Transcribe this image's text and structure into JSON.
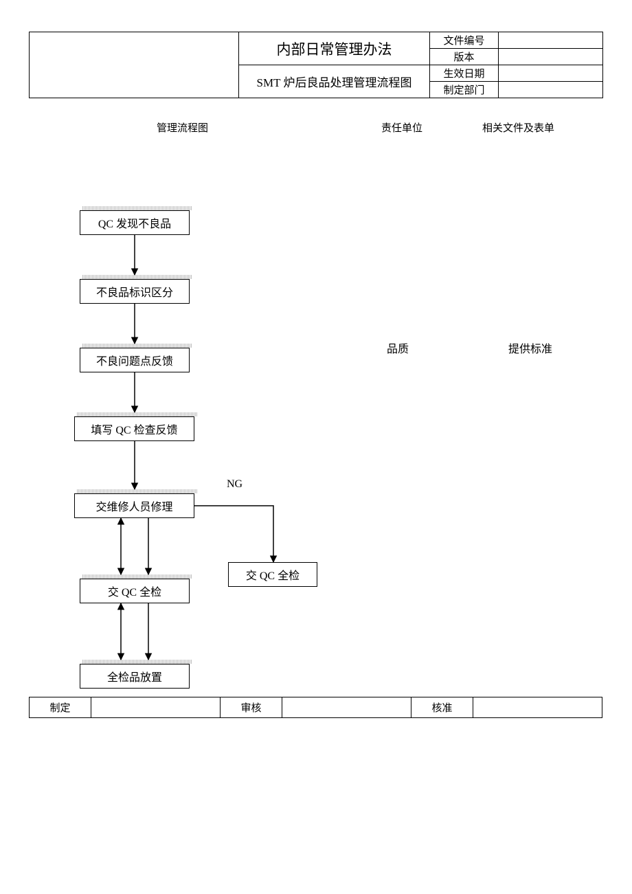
{
  "header": {
    "title1": "内部日常管理办法",
    "title2": "SMT 炉后良品处理管理流程图",
    "labels": {
      "docno": "文件编号",
      "ver": "版本",
      "eff": "生效日期",
      "dept": "制定部门"
    },
    "values": {
      "docno": "",
      "ver": "",
      "eff": "",
      "dept": ""
    }
  },
  "columns": {
    "flow": "管理流程图",
    "owner": "责任单位",
    "docs": "相关文件及表单"
  },
  "sidetext": {
    "owner": "品质",
    "docs": "提供标准"
  },
  "flow": {
    "step1": "QC 发现不良品",
    "step2": "不良品标识区分",
    "step3": "不良问题点反馈",
    "step4": "填写 QC 检查反馈",
    "step5": "交维修人员修理",
    "step6": "交 QC 全检",
    "step7": "全检品放置",
    "step8": "交 QC 全检",
    "ng": "NG"
  },
  "footer": {
    "make": "制定",
    "review": "审核",
    "approve": "核准",
    "make_v": "",
    "review_v": "",
    "approve_v": ""
  }
}
